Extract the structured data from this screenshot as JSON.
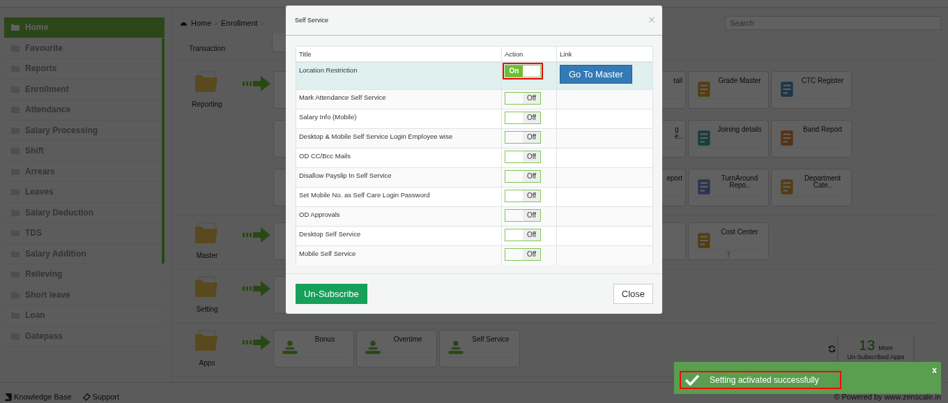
{
  "sidebar": {
    "items": [
      {
        "label": "Home",
        "selected": true
      },
      {
        "label": "Favourite",
        "selected": false
      },
      {
        "label": "Reports",
        "selected": false
      },
      {
        "label": "Enrollment",
        "selected": false
      },
      {
        "label": "Attendance",
        "selected": false
      },
      {
        "label": "Salary Processing",
        "selected": false
      },
      {
        "label": "Shift",
        "selected": false
      },
      {
        "label": "Arrears",
        "selected": false
      },
      {
        "label": "Leaves",
        "selected": false
      },
      {
        "label": "Salary Deduction",
        "selected": false
      },
      {
        "label": "TDS",
        "selected": false
      },
      {
        "label": "Salary Addition",
        "selected": false
      },
      {
        "label": "Relieving",
        "selected": false
      },
      {
        "label": "Short leave",
        "selected": false
      },
      {
        "label": "Loan",
        "selected": false
      },
      {
        "label": "Gatepass",
        "selected": false
      }
    ]
  },
  "breadcrumb": {
    "items": [
      "Home",
      "›",
      "Enrollment",
      "›"
    ]
  },
  "search": {
    "placeholder": "Search"
  },
  "transaction": {
    "label": "Transaction"
  },
  "sections": [
    {
      "label": "Reporting",
      "rows": [
        {
          "cards": [
            {
              "title": "tail"
            },
            {
              "title": "Grade Master"
            },
            {
              "title": "CTC Register"
            }
          ]
        },
        {
          "cards": [
            {
              "title": "g\ne.."
            },
            {
              "title": "Joining details"
            },
            {
              "title": "Band Report"
            }
          ]
        },
        {
          "cards": [
            {
              "title": "eport"
            },
            {
              "title": "TurnAround\nRepo.."
            },
            {
              "title": "Department\nCate.."
            }
          ]
        }
      ]
    },
    {
      "label": "Master",
      "rows": [
        {
          "cards": [
            {
              "title": "Cost Center",
              "count": "7"
            }
          ]
        }
      ]
    },
    {
      "label": "Setting"
    },
    {
      "label": "Apps",
      "rows": [
        {
          "cards": [
            {
              "title": "Bonus"
            },
            {
              "title": "Overtime"
            },
            {
              "title": "Self Service"
            }
          ]
        }
      ],
      "more": {
        "count": "13",
        "word": "More",
        "caption": "Un-Subscribed Apps"
      }
    }
  ],
  "footer": {
    "links": [
      "Knowledge Base",
      "Support"
    ],
    "powered": "© Powered by www.zenscale.in"
  },
  "modal": {
    "title": "Self Service",
    "close": "×",
    "columns": [
      "Title",
      "Action",
      "Link"
    ],
    "rows": [
      {
        "title": "Location Restriction",
        "on": true,
        "selected": true,
        "highlighted": true,
        "toggle_label": "On",
        "link": "Go To Master"
      },
      {
        "title": "Mark Attendance Self Service",
        "on": false,
        "selected": false,
        "highlighted": false,
        "toggle_label": "Off"
      },
      {
        "title": "Salary Info (Mobile)",
        "on": false,
        "selected": false,
        "highlighted": false,
        "toggle_label": "Off"
      },
      {
        "title": "Desktop & Mobile Self Service Login Employee wise",
        "on": false,
        "selected": false,
        "highlighted": false,
        "toggle_label": "Off"
      },
      {
        "title": "OD CC/Bcc Mails",
        "on": false,
        "selected": false,
        "highlighted": false,
        "toggle_label": "Off"
      },
      {
        "title": "Disallow Payslip In Self Service",
        "on": false,
        "selected": false,
        "highlighted": false,
        "toggle_label": "Off"
      },
      {
        "title": "Set Mobile No. as Self Care Login Password",
        "on": false,
        "selected": false,
        "highlighted": false,
        "toggle_label": "Off"
      },
      {
        "title": "OD Approvals",
        "on": false,
        "selected": false,
        "highlighted": false,
        "toggle_label": "Off"
      },
      {
        "title": "Desktop Self Service",
        "on": false,
        "selected": false,
        "highlighted": false,
        "toggle_label": "Off"
      },
      {
        "title": "Mobile Self Service",
        "on": false,
        "selected": false,
        "highlighted": false,
        "toggle_label": "Off"
      }
    ],
    "buttons": [
      "Un-Subscribe",
      "Close"
    ]
  },
  "toast": {
    "message": "Setting activated successfully",
    "close": "x",
    "highlighted": true
  }
}
